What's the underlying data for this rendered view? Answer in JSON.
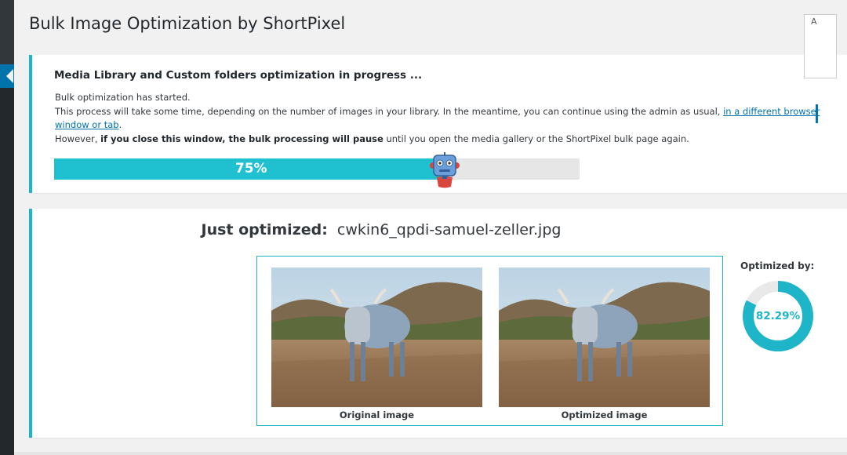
{
  "page_title": "Bulk Image Optimization by ShortPixel",
  "progress": {
    "heading": "Media Library and Custom folders optimization in progress ...",
    "line1": "Bulk optimization has started.",
    "line2_before": "This process will take some time, depending on the number of images in your library. In the meantime, you can continue using the admin as usual, ",
    "line2_link": "in a different browser window or tab",
    "line2_after": ".",
    "line3_before": "However, ",
    "line3_bold": "if you close this window, the bulk processing will pause",
    "line3_after": " until you open the media gallery or the ShortPixel bulk page again.",
    "percent_label": "75%",
    "percent_value": 0.75
  },
  "side_panel": {
    "letter": "A"
  },
  "result": {
    "title_label": "Just optimized:",
    "filename": "cwkin6_qpdi-samuel-zeller.jpg",
    "original_caption": "Original image",
    "optimized_caption": "Optimized image",
    "optimized_by_label": "Optimized by:",
    "optimized_by_value": "82.29%",
    "optimized_by_fraction": 0.8229
  },
  "colors": {
    "accent": "#1fc0cf",
    "link": "#0073aa",
    "sidebar": "#23282d"
  }
}
